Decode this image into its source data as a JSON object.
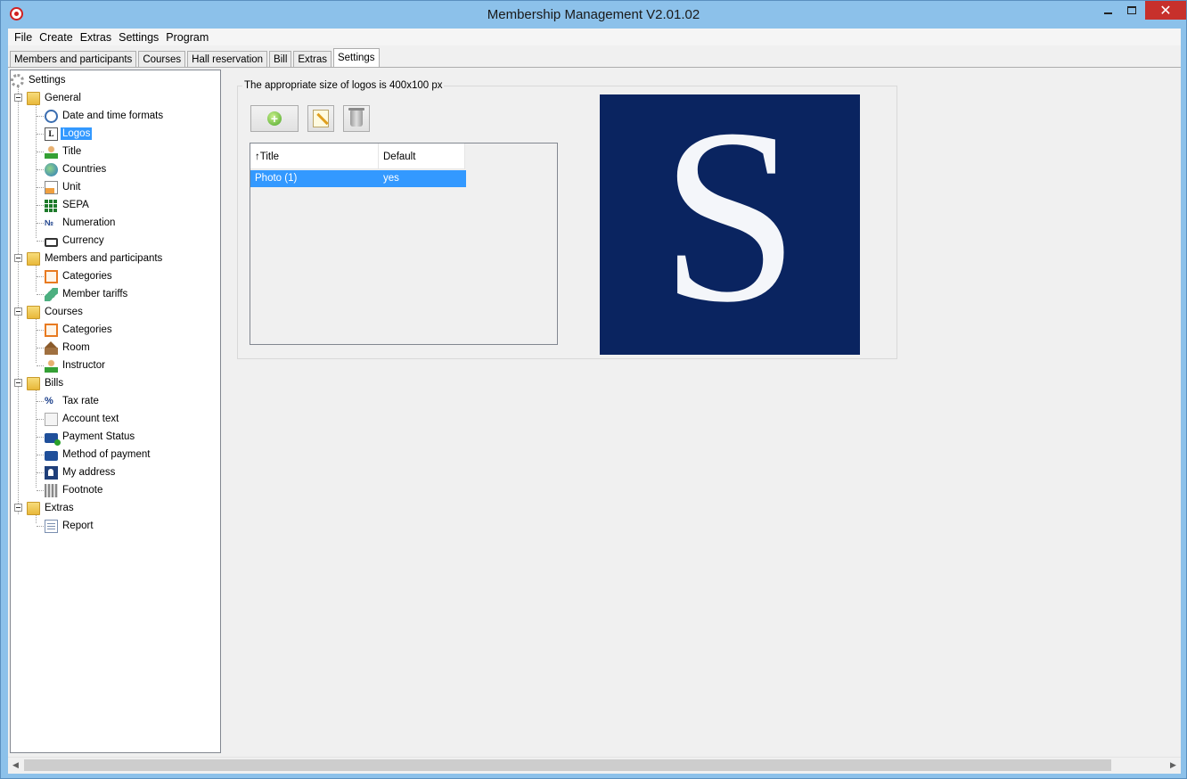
{
  "window": {
    "title": "Membership Management V2.01.02",
    "close_glyph": "✕"
  },
  "menubar": {
    "items": [
      "File",
      "Create",
      "Extras",
      "Settings",
      "Program"
    ]
  },
  "tabs": {
    "items": [
      "Members and participants",
      "Courses",
      "Hall reservation",
      "Bill",
      "Extras",
      "Settings"
    ],
    "active": "Settings"
  },
  "tree": {
    "root": "Settings",
    "groups": [
      {
        "label": "General",
        "items": [
          "Date and time formats",
          "Logos",
          "Title",
          "Countries",
          "Unit",
          "SEPA",
          "Numeration",
          "Currency"
        ]
      },
      {
        "label": "Members and participants",
        "items": [
          "Categories",
          "Member tariffs"
        ]
      },
      {
        "label": "Courses",
        "items": [
          "Categories",
          "Room",
          "Instructor"
        ]
      },
      {
        "label": "Bills",
        "items": [
          "Tax rate",
          "Account text",
          "Payment Status",
          "Method of payment",
          "My address",
          "Footnote"
        ]
      },
      {
        "label": "Extras",
        "items": [
          "Report"
        ]
      }
    ],
    "selected": "Logos",
    "icons": {
      "numeration": "№",
      "tax_rate": "%",
      "logo": "L"
    }
  },
  "logos_panel": {
    "group_title": "The appropriate size of logos is 400x100 px",
    "table": {
      "columns": [
        "Title",
        "Default"
      ],
      "sort_indicator": "↑",
      "rows": [
        {
          "title": "Photo (1)",
          "default": "yes"
        }
      ]
    },
    "preview_letter": "S",
    "add_glyph": "+"
  },
  "scrollbar": {
    "left_glyph": "◀",
    "right_glyph": "▶"
  },
  "colors": {
    "titlebar": "#8cc1ea",
    "selection": "#3399ff",
    "logo_background": "#0a2460",
    "close_button": "#c7302b"
  }
}
